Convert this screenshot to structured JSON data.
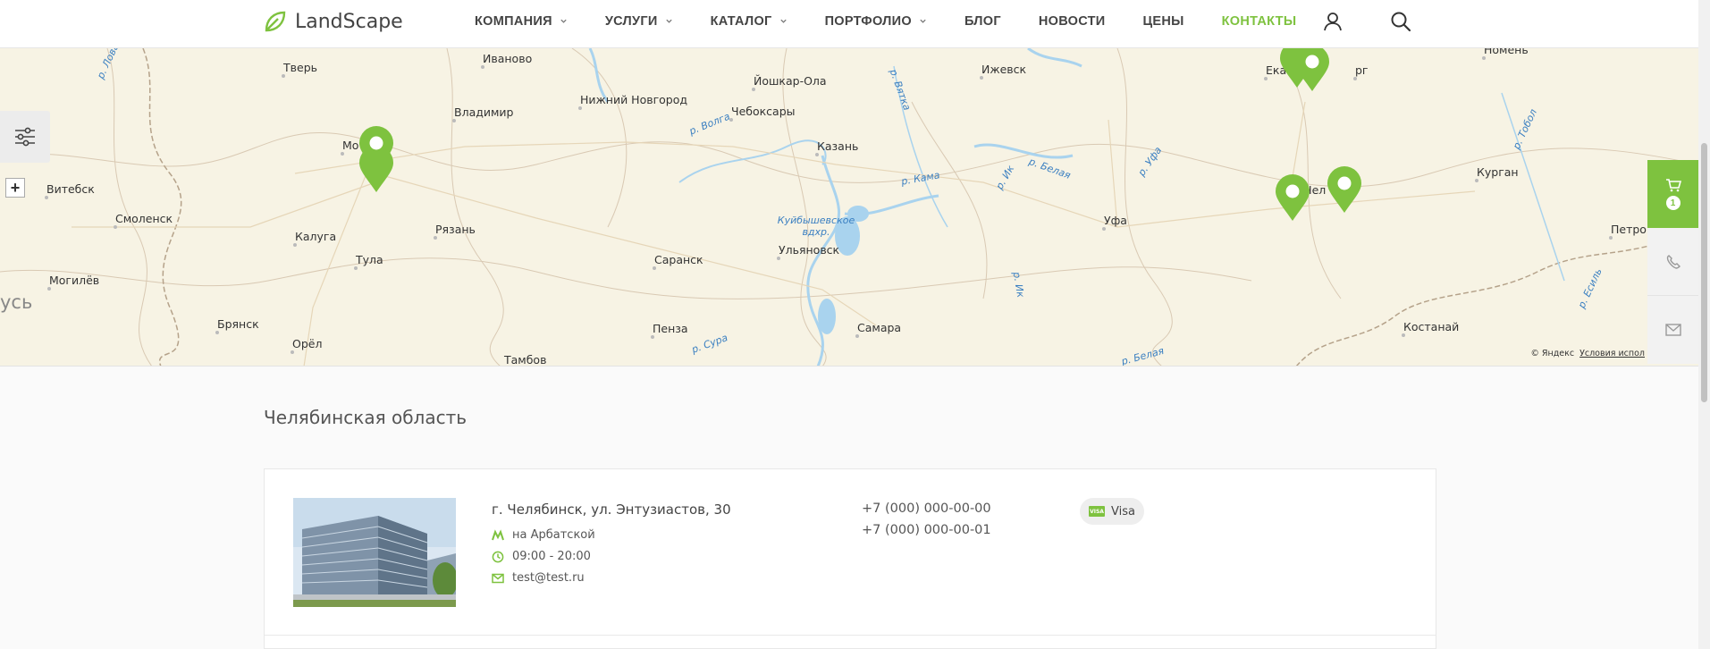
{
  "header": {
    "logo_text": "LandScape",
    "nav": [
      {
        "label": "КОМПАНИЯ",
        "dropdown": true
      },
      {
        "label": "УСЛУГИ",
        "dropdown": true
      },
      {
        "label": "КАТАЛОГ",
        "dropdown": true
      },
      {
        "label": "ПОРТФОЛИО",
        "dropdown": true
      },
      {
        "label": "БЛОГ",
        "dropdown": false
      },
      {
        "label": "НОВОСТИ",
        "dropdown": false
      },
      {
        "label": "ЦЕНЫ",
        "dropdown": false
      },
      {
        "label": "КОНТАКТЫ",
        "dropdown": false,
        "active": true
      }
    ],
    "icons": [
      "user-icon",
      "search-icon"
    ]
  },
  "map": {
    "cities": [
      "Тверь",
      "Иваново",
      "Йошкар-Ола",
      "Ижевск",
      "Екатеринбург",
      "Номень",
      "Владимир",
      "Нижний Новгород",
      "Чебоксары",
      "Казань",
      "Москва",
      "Витебск",
      "Смоленск",
      "Калуга",
      "Рязань",
      "Саранск",
      "Ульяновск",
      "Уфа",
      "Челябинск",
      "Курган",
      "Петропавловск",
      "Тула",
      "Могилёв",
      "Брянск",
      "Орёл",
      "Пенза",
      "Самара",
      "Тамбов",
      "Костанай"
    ],
    "city_labels": {
      "tver": "Тверь",
      "ivanovo": "Иваново",
      "yoshkar": "Йошкар-Ола",
      "izhevsk": "Ижевск",
      "ekb_a": "Ека",
      "ekb_b": "рг",
      "tyumen": "Номень",
      "vladimir": "Владимир",
      "nnovgorod": "Нижний Новгород",
      "cheboksary": "Чебоксары",
      "kazan": "Казань",
      "moscow": "Мо",
      "vitebsk": "Витебск",
      "smolensk": "Смоленск",
      "kaluga": "Калуга",
      "ryazan": "Рязань",
      "saransk": "Саранск",
      "ulyanovsk": "Ульяновск",
      "ufa": "Уфа",
      "chel": "Чел",
      "kurgan": "Курган",
      "petro": "Петроп",
      "tula": "Тула",
      "mogilev": "Могилёв",
      "bryansk": "Брянск",
      "orel": "Орёл",
      "penza": "Пенза",
      "samara": "Самара",
      "tambov": "Тамбов",
      "kostanay": "Костанай"
    },
    "rivers": {
      "volga": "р. Волга",
      "vyatka": "р. Вятка",
      "kama": "р. Кама",
      "ik": "р. Ик",
      "belaya": "р. Белая",
      "ufa_r": "р. Уфа",
      "tobol": "р. Тобол",
      "ik2": "р. Ик",
      "sura": "р. Сура",
      "belaya2": "р. Белая",
      "esil": "р. Есиль",
      "lovat": "р. Ловать",
      "reservoir": "Куйбышевское вдхр."
    },
    "country_label": "усь",
    "copyright": "© Яндекс",
    "terms": "Условия испол",
    "controls": {
      "filter": "filter-icon",
      "zoom_plus": "+"
    }
  },
  "side_rail": {
    "cart_count": "1",
    "icons": [
      "cart-icon",
      "phone-icon",
      "mail-icon"
    ]
  },
  "content": {
    "region_title": "Челябинская область",
    "office": {
      "address": "г. Челябинск, ул. Энтузиастов, 30",
      "metro": "на Арбатской",
      "hours": "09:00 - 20:00",
      "email": "test@test.ru",
      "phones": [
        "+7 (000) 000-00-00",
        "+7 (000) 000-00-01"
      ],
      "payment": "Visa",
      "payment_icon_text": "VISA"
    }
  },
  "colors": {
    "accent": "#7ec23f",
    "text": "#444444",
    "map_bg": "#f7f3e4",
    "water": "#a9d3ee"
  }
}
